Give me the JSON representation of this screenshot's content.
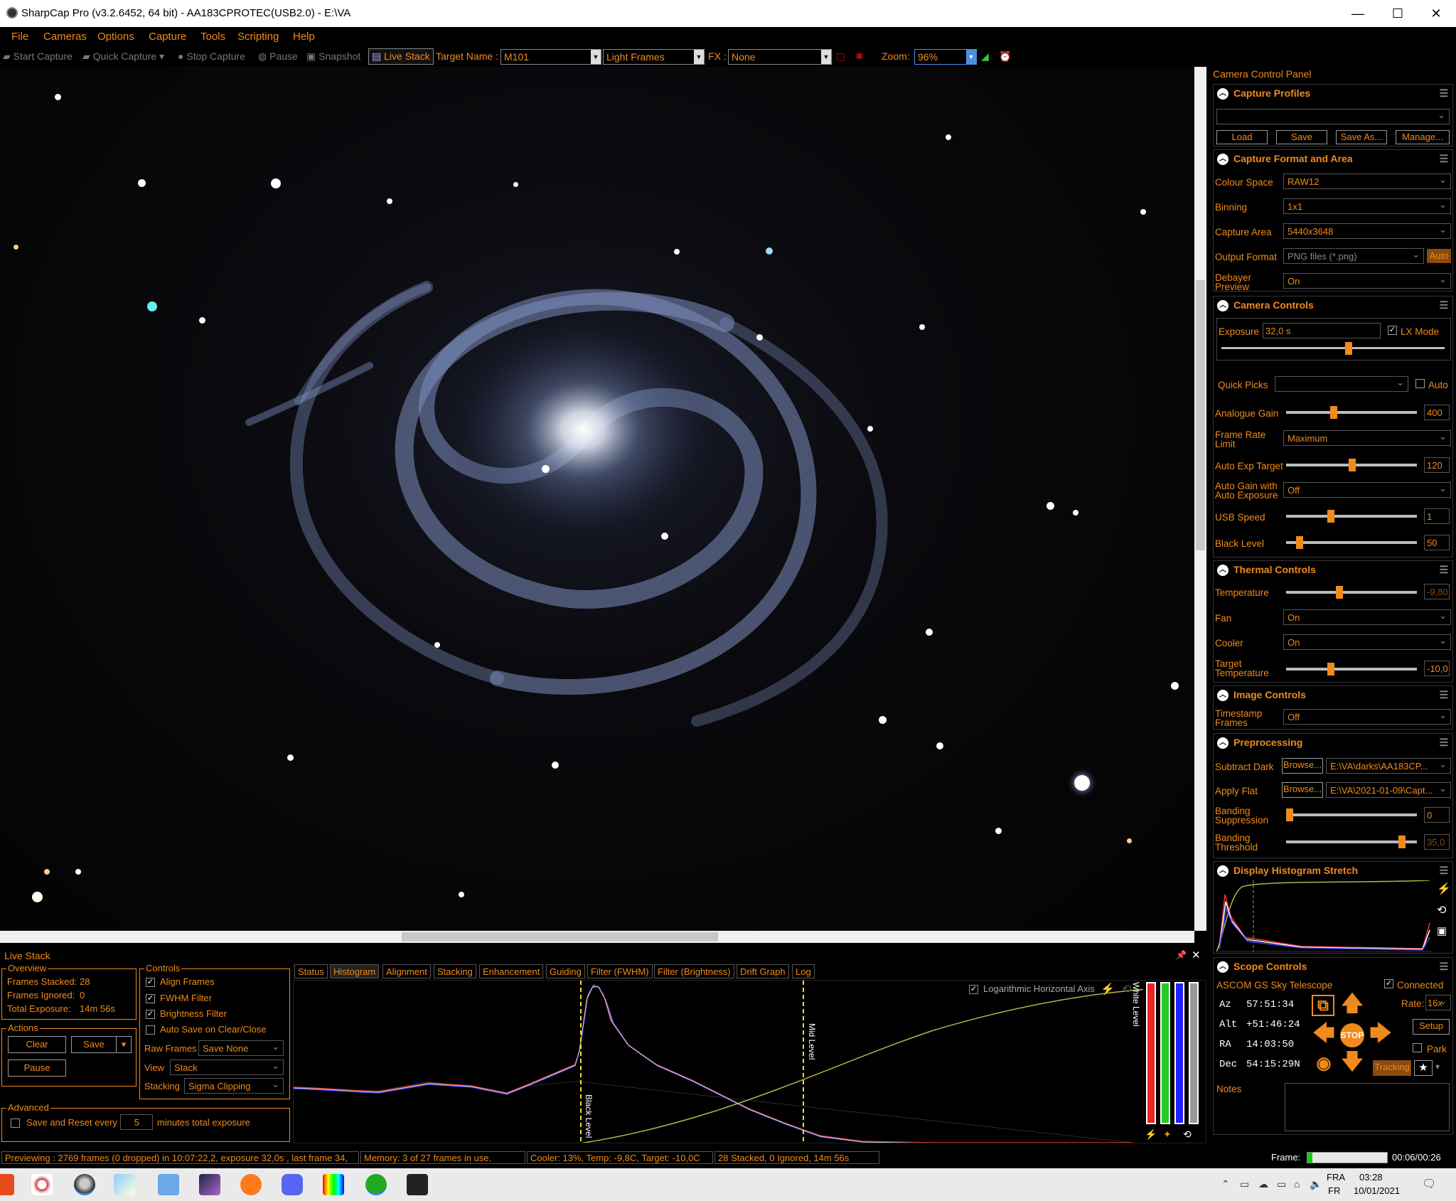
{
  "window": {
    "title": "SharpCap Pro (v3.2.6452, 64 bit) - AA183CPROTEC(USB2.0) - E:\\VA",
    "minimize": "—",
    "maximize": "☐",
    "close": "✕"
  },
  "menu": [
    "File",
    "Cameras",
    "Options",
    "Capture",
    "Tools",
    "Scripting",
    "Help"
  ],
  "toolbar": {
    "start_capture": "Start Capture",
    "quick_capture": "Quick Capture",
    "stop_capture": "Stop Capture",
    "pause": "Pause",
    "snapshot": "Snapshot",
    "live_stack": "Live Stack",
    "target_name_label": "Target Name :",
    "target_name_value": "M101",
    "frame_type": "Light Frames",
    "fx_label": "FX :",
    "fx_value": "None",
    "zoom_label": "Zoom:",
    "zoom_value": "96%"
  },
  "ccp": {
    "title": "Camera Control Panel",
    "capture_profiles": {
      "title": "Capture Profiles",
      "profile_value": "",
      "load": "Load",
      "save": "Save",
      "save_as": "Save As...",
      "manage": "Manage..."
    },
    "capture_format": {
      "title": "Capture Format and Area",
      "colour_space_label": "Colour Space",
      "colour_space": "RAW12",
      "binning_label": "Binning",
      "binning": "1x1",
      "capture_area_label": "Capture Area",
      "capture_area": "5440x3648",
      "output_format_label": "Output Format",
      "output_format": "PNG files (*.png)",
      "auto": "Auto",
      "debayer_label_1": "Debayer",
      "debayer_label_2": "Preview",
      "debayer": "On"
    },
    "camera_controls": {
      "title": "Camera Controls",
      "exposure_label": "Exposure",
      "exposure": "32,0 s",
      "lx_mode": "LX Mode",
      "quick_picks_label": "Quick Picks",
      "quick_picks_auto": "Auto",
      "analogue_gain_label": "Analogue Gain",
      "analogue_gain": "400",
      "frame_rate_label_1": "Frame Rate",
      "frame_rate_label_2": "Limit",
      "frame_rate": "Maximum",
      "auto_exp_label": "Auto Exp Target",
      "auto_exp": "120",
      "auto_gain_label_1": "Auto Gain with",
      "auto_gain_label_2": "Auto Exposure",
      "auto_gain": "Off",
      "usb_speed_label": "USB Speed",
      "usb_speed": "1",
      "black_level_label": "Black Level",
      "black_level": "50"
    },
    "thermal_controls": {
      "title": "Thermal Controls",
      "temperature_label": "Temperature",
      "temperature": "-9,80",
      "fan_label": "Fan",
      "fan": "On",
      "cooler_label": "Cooler",
      "cooler": "On",
      "target_temp_label_1": "Target",
      "target_temp_label_2": "Temperature",
      "target_temp": "-10,0"
    },
    "image_controls": {
      "title": "Image Controls",
      "timestamp_label_1": "Timestamp",
      "timestamp_label_2": "Frames",
      "timestamp": "Off"
    },
    "preprocessing": {
      "title": "Preprocessing",
      "subtract_dark_label": "Subtract Dark",
      "browse": "Browse...",
      "subtract_dark": "E:\\VA\\darks\\AA183CP...",
      "apply_flat_label": "Apply Flat",
      "apply_flat": "E:\\VA\\2021-01-09\\Capt...",
      "banding_supp_label_1": "Banding",
      "banding_supp_label_2": "Suppression",
      "banding_supp": "0",
      "banding_thresh_label_1": "Banding",
      "banding_thresh_label_2": "Threshold",
      "banding_thresh": "35,0"
    },
    "display_histogram": {
      "title": "Display Histogram Stretch"
    },
    "scope_controls": {
      "title": "Scope Controls",
      "scope_name": "ASCOM GS Sky Telescope",
      "connected": "Connected",
      "az_label": "Az",
      "az": "57:51:34",
      "alt_label": "Alt",
      "alt": "+51:46:24",
      "ra_label": "RA",
      "ra": "14:03:50",
      "dec_label": "Dec",
      "dec": "54:15:29N",
      "rate_label": "Rate:",
      "rate": "16x",
      "setup": "Setup",
      "park": "Park",
      "stop": "STOP",
      "tracking": "Tracking",
      "notes_label": "Notes",
      "notes": ""
    }
  },
  "live_stack": {
    "title": "Live Stack",
    "overview_title": "Overview",
    "frames_stacked_label": "Frames Stacked:",
    "frames_stacked": "28",
    "frames_ignored_label": "Frames Ignored:",
    "frames_ignored": "0",
    "total_exposure_label": "Total Exposure:",
    "total_exposure": "14m 56s",
    "actions_title": "Actions",
    "clear": "Clear",
    "save": "Save",
    "pause": "Pause",
    "controls_title": "Controls",
    "align_frames": "Align Frames",
    "fwhm_filter": "FWHM Filter",
    "brightness_filter": "Brightness Filter",
    "auto_save": "Auto Save on Clear/Close",
    "raw_frames_label": "Raw Frames",
    "raw_frames": "Save None",
    "view_label": "View",
    "view": "Stack",
    "stacking_label": "Stacking",
    "stacking": "Sigma Clipping",
    "advanced_title": "Advanced",
    "save_reset_label": "Save and Reset every",
    "save_reset_value": "5",
    "save_reset_suffix": "minutes total exposure",
    "tabs": [
      "Status",
      "Histogram",
      "Alignment",
      "Stacking",
      "Enhancement",
      "Guiding",
      "Filter (FWHM)",
      "Filter (Brightness)",
      "Drift Graph",
      "Log"
    ],
    "log_axis": "Logarithmic Horizontal Axis",
    "black_level_marker": "Black Level",
    "mid_level_marker": "Mid Level",
    "white_level_marker": "White Level"
  },
  "status": {
    "previewing": "Previewing : 2769 frames (0 dropped) in 10:07:22,2, exposure 32,0s , last frame 34,",
    "memory": "Memory: 3 of 27 frames in use.",
    "cooler": "Cooler: 13%, Temp: -9,8C, Target: -10,0C",
    "stacked": "28 Stacked, 0 Ignored, 14m 56s",
    "frame_label": "Frame:",
    "frame_time": "00:06/00:26",
    "frame_progress": 0.06
  },
  "taskbar": {
    "lang": "FRA",
    "lang2": "FR",
    "time": "03:28",
    "date": "10/01/2021"
  },
  "colors": {
    "accent": "#f08a1c",
    "background": "#000000"
  }
}
